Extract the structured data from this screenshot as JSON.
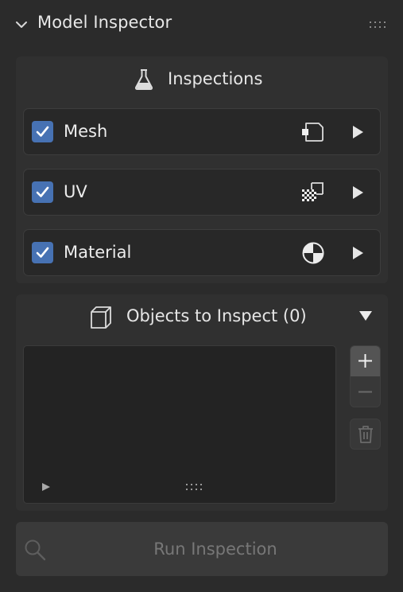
{
  "panel": {
    "title": "Model Inspector"
  },
  "inspections": {
    "title": "Inspections",
    "items": [
      {
        "label": "Mesh",
        "checked": true,
        "icon": "mesh-face-icon"
      },
      {
        "label": "UV",
        "checked": true,
        "icon": "uv-checker-icon"
      },
      {
        "label": "Material",
        "checked": true,
        "icon": "material-sphere-icon"
      }
    ]
  },
  "objects": {
    "title": "Objects to Inspect (0)"
  },
  "run_button": {
    "label": "Run Inspection"
  },
  "colors": {
    "background": "#2b2b2b",
    "box": "#303030",
    "row": "#282828",
    "checkbox": "#4772b3",
    "disabled_text": "#777777"
  }
}
